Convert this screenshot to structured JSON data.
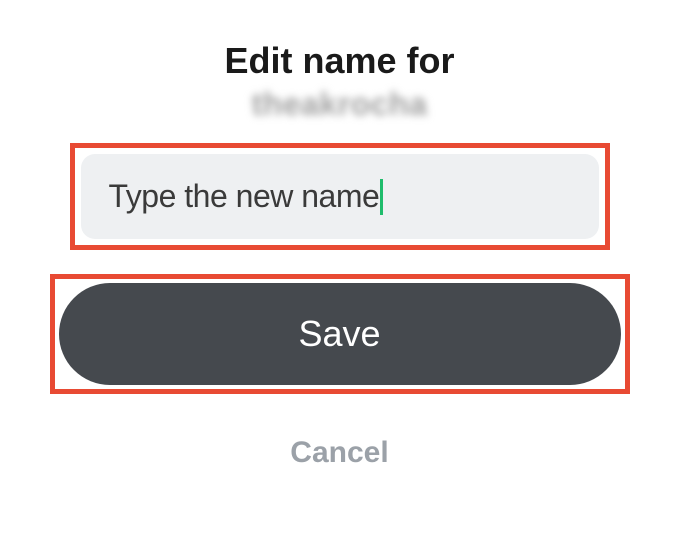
{
  "header": {
    "title": "Edit name for",
    "username": "theakrocha"
  },
  "input": {
    "placeholder": "Type the new name",
    "value": "Type the new name"
  },
  "buttons": {
    "save_label": "Save",
    "cancel_label": "Cancel"
  }
}
